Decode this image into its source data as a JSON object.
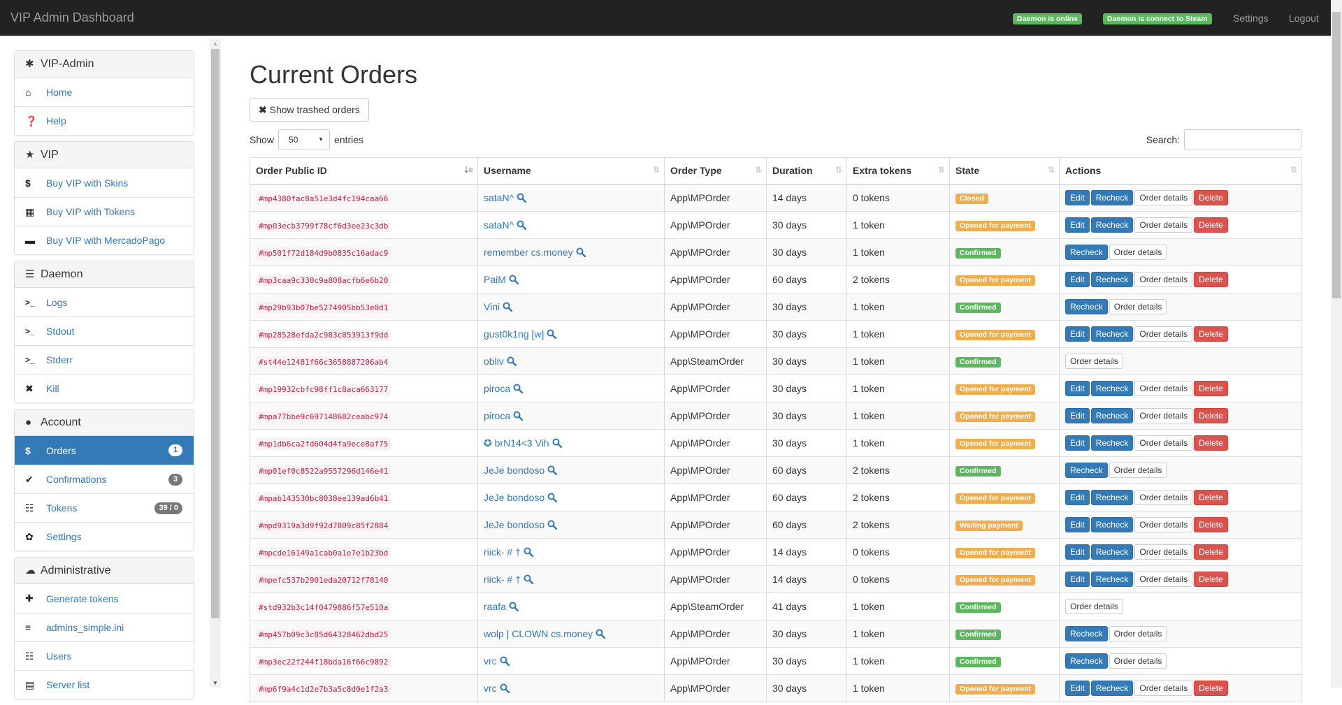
{
  "navbar": {
    "brand": "VIP Admin Dashboard",
    "status_online": "Daemon is online",
    "status_steam": "Daemon is connect to Steam",
    "settings": "Settings",
    "logout": "Logout"
  },
  "sidebar": {
    "groups": [
      {
        "title": "VIP-Admin",
        "icon": "asterisk-icon",
        "items": [
          {
            "label": "Home",
            "icon": "home-icon"
          },
          {
            "label": "Help",
            "icon": "question-icon"
          }
        ]
      },
      {
        "title": "VIP",
        "icon": "star-icon",
        "items": [
          {
            "label": "Buy VIP with Skins",
            "icon": "dollar-icon"
          },
          {
            "label": "Buy VIP with Tokens",
            "icon": "gift-icon"
          },
          {
            "label": "Buy VIP with MercadoPago",
            "icon": "credit-card-icon"
          }
        ]
      },
      {
        "title": "Daemon",
        "icon": "tasks-icon",
        "items": [
          {
            "label": "Logs",
            "icon": "console-icon"
          },
          {
            "label": "Stdout",
            "icon": "console-icon"
          },
          {
            "label": "Stderr",
            "icon": "console-icon"
          },
          {
            "label": "Kill",
            "icon": "close-icon"
          }
        ]
      },
      {
        "title": "Account",
        "icon": "user-icon",
        "items": [
          {
            "label": "Orders",
            "icon": "dollar-icon",
            "badge": "1",
            "active": true
          },
          {
            "label": "Confirmations",
            "icon": "check-icon",
            "badge": "3"
          },
          {
            "label": "Tokens",
            "icon": "list-icon",
            "badge": "39 / 0"
          },
          {
            "label": "Settings",
            "icon": "gear-icon"
          }
        ]
      },
      {
        "title": "Administrative",
        "icon": "cloud-icon",
        "items": [
          {
            "label": "Generate tokens",
            "icon": "plus-icon"
          },
          {
            "label": "admins_simple.ini",
            "icon": "align-icon"
          },
          {
            "label": "Users",
            "icon": "list-icon"
          },
          {
            "label": "Server list",
            "icon": "hdd-icon"
          }
        ]
      }
    ]
  },
  "main": {
    "title": "Current Orders",
    "show_trashed": "Show trashed orders",
    "show_label": "Show",
    "entries_value": "50",
    "entries_label": "entries",
    "search_label": "Search:",
    "search_value": "",
    "columns": [
      "Order Public ID",
      "Username",
      "Order Type",
      "Duration",
      "Extra tokens",
      "State",
      "Actions"
    ],
    "action_labels": {
      "edit": "Edit",
      "recheck": "Recheck",
      "details": "Order details",
      "delete": "Delete"
    },
    "rows": [
      {
        "id": "#mp4380fac8a51e3d4fc194caa66",
        "user": "sataN^",
        "type": "App\\MPOrder",
        "duration": "14 days",
        "tokens": "0 tokens",
        "state": "Closed",
        "actions": [
          "edit",
          "recheck",
          "details",
          "delete"
        ]
      },
      {
        "id": "#mp03ecb3799f78cf6d3ee23c3db",
        "user": "sataN^",
        "type": "App\\MPOrder",
        "duration": "30 days",
        "tokens": "1 token",
        "state": "Opened for payment",
        "actions": [
          "edit",
          "recheck",
          "details",
          "delete"
        ]
      },
      {
        "id": "#mp501f72d184d9b0835c16adac9",
        "user": "remember cs.money",
        "type": "App\\MPOrder",
        "duration": "30 days",
        "tokens": "1 token",
        "state": "Confirmed",
        "actions": [
          "recheck",
          "details"
        ]
      },
      {
        "id": "#mp3caa9c330c9a808acfb6e6b20",
        "user": "PaiM",
        "type": "App\\MPOrder",
        "duration": "60 days",
        "tokens": "2 tokens",
        "state": "Opened for payment",
        "actions": [
          "edit",
          "recheck",
          "details",
          "delete"
        ]
      },
      {
        "id": "#mp29b93b07be5274905bb53e0d1",
        "user": "Vini",
        "type": "App\\MPOrder",
        "duration": "30 days",
        "tokens": "1 token",
        "state": "Confirmed",
        "actions": [
          "recheck",
          "details"
        ]
      },
      {
        "id": "#mp28528efda2c983c853913f9dd",
        "user": "gust0k1ng [w]",
        "type": "App\\MPOrder",
        "duration": "30 days",
        "tokens": "1 token",
        "state": "Opened for payment",
        "actions": [
          "edit",
          "recheck",
          "details",
          "delete"
        ]
      },
      {
        "id": "#st44e12481f66c3658887206ab4",
        "user": "obliv",
        "type": "App\\SteamOrder",
        "duration": "30 days",
        "tokens": "1 token",
        "state": "Confirmed",
        "actions": [
          "details"
        ]
      },
      {
        "id": "#mp19932cbfc98ff1c8aca663177",
        "user": "piroca",
        "type": "App\\MPOrder",
        "duration": "30 days",
        "tokens": "1 token",
        "state": "Opened for payment",
        "actions": [
          "edit",
          "recheck",
          "details",
          "delete"
        ]
      },
      {
        "id": "#mpa77bbe9c697148682ceabc974",
        "user": "piroca",
        "type": "App\\MPOrder",
        "duration": "30 days",
        "tokens": "1 token",
        "state": "Opened for payment",
        "actions": [
          "edit",
          "recheck",
          "details",
          "delete"
        ]
      },
      {
        "id": "#mp1db6ca2fd604d4fa9ece8af75",
        "user": "✪ brN14<3 Vih",
        "type": "App\\MPOrder",
        "duration": "30 days",
        "tokens": "1 token",
        "state": "Opened for payment",
        "actions": [
          "edit",
          "recheck",
          "details",
          "delete"
        ]
      },
      {
        "id": "#mp01ef0c8522a9557296d146e41",
        "user": "JeJe bondoso",
        "type": "App\\MPOrder",
        "duration": "60 days",
        "tokens": "2 tokens",
        "state": "Confirmed",
        "actions": [
          "recheck",
          "details"
        ]
      },
      {
        "id": "#mpab143530bc8038ee139ad6b41",
        "user": "JeJe bondoso",
        "type": "App\\MPOrder",
        "duration": "60 days",
        "tokens": "2 tokens",
        "state": "Opened for payment",
        "actions": [
          "edit",
          "recheck",
          "details",
          "delete"
        ]
      },
      {
        "id": "#mpd9319a3d9f92d7809c85f2884",
        "user": "JeJe bondoso",
        "type": "App\\MPOrder",
        "duration": "60 days",
        "tokens": "2 tokens",
        "state": "Waiting payment",
        "actions": [
          "edit",
          "recheck",
          "details",
          "delete"
        ]
      },
      {
        "id": "#mpcde16149a1cab0a1e7e1b23bd",
        "user": "riick- # †",
        "type": "App\\MPOrder",
        "duration": "14 days",
        "tokens": "0 tokens",
        "state": "Opened for payment",
        "actions": [
          "edit",
          "recheck",
          "details",
          "delete"
        ]
      },
      {
        "id": "#mpefc537b2901eda20712f78140",
        "user": "riick- # †",
        "type": "App\\MPOrder",
        "duration": "14 days",
        "tokens": "0 tokens",
        "state": "Opened for payment",
        "actions": [
          "edit",
          "recheck",
          "details",
          "delete"
        ]
      },
      {
        "id": "#std932b3c14f0479886f57e510a",
        "user": "raafa",
        "type": "App\\SteamOrder",
        "duration": "41 days",
        "tokens": "1 token",
        "state": "Confirmed",
        "actions": [
          "details"
        ]
      },
      {
        "id": "#mp457b09c3c85d64328462dbd25",
        "user": "wolp | CLOWN cs.money",
        "type": "App\\MPOrder",
        "duration": "30 days",
        "tokens": "1 token",
        "state": "Confirmed",
        "actions": [
          "recheck",
          "details"
        ]
      },
      {
        "id": "#mp3ec22f244f18bda16f66c9892",
        "user": "vrc",
        "type": "App\\MPOrder",
        "duration": "30 days",
        "tokens": "1 token",
        "state": "Confirmed",
        "actions": [
          "recheck",
          "details"
        ]
      },
      {
        "id": "#mp6f9a4c1d2e7b3a5c8d0e1f2a3",
        "user": "vrc",
        "type": "App\\MPOrder",
        "duration": "30 days",
        "tokens": "1 token",
        "state": "Opened for payment",
        "actions": [
          "edit",
          "recheck",
          "details",
          "delete"
        ]
      }
    ]
  },
  "colors": {
    "navbar": "#222222",
    "link": "#337ab7",
    "primary": "#337ab7",
    "success": "#5cb85c",
    "warning": "#f0ad4e",
    "danger": "#d9534f",
    "code": "#c7254e"
  }
}
